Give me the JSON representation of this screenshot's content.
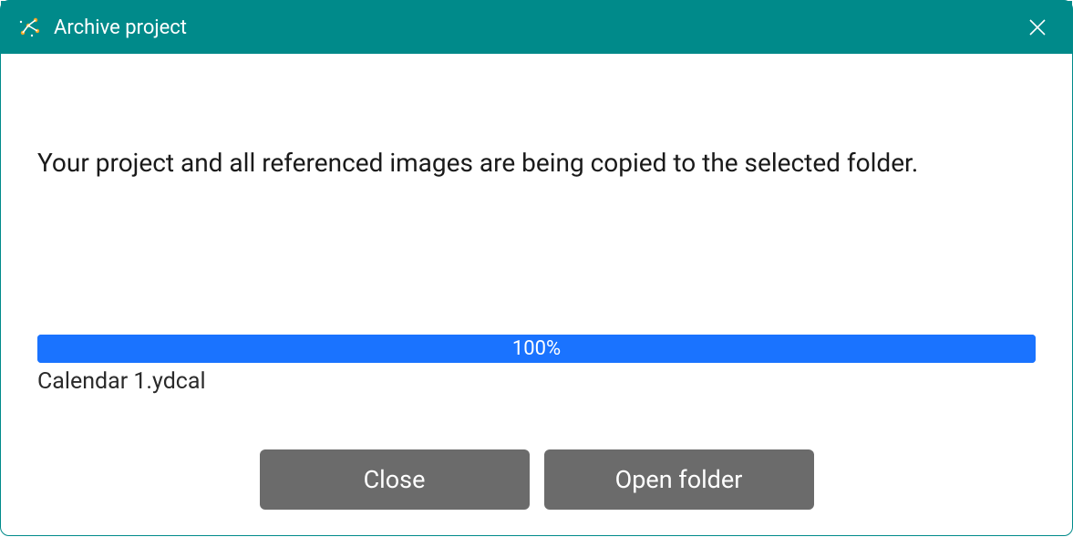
{
  "titlebar": {
    "title": "Archive project"
  },
  "main": {
    "message": "Your project and all referenced images are being copied to the selected folder.",
    "progress_percent": "100%",
    "progress_value": 100,
    "filename": "Calendar 1.ydcal"
  },
  "buttons": {
    "close": "Close",
    "open_folder": "Open folder"
  },
  "colors": {
    "titlebar_bg": "#008a8a",
    "progress_fill": "#1a73ff",
    "button_bg": "#6b6b6b"
  }
}
